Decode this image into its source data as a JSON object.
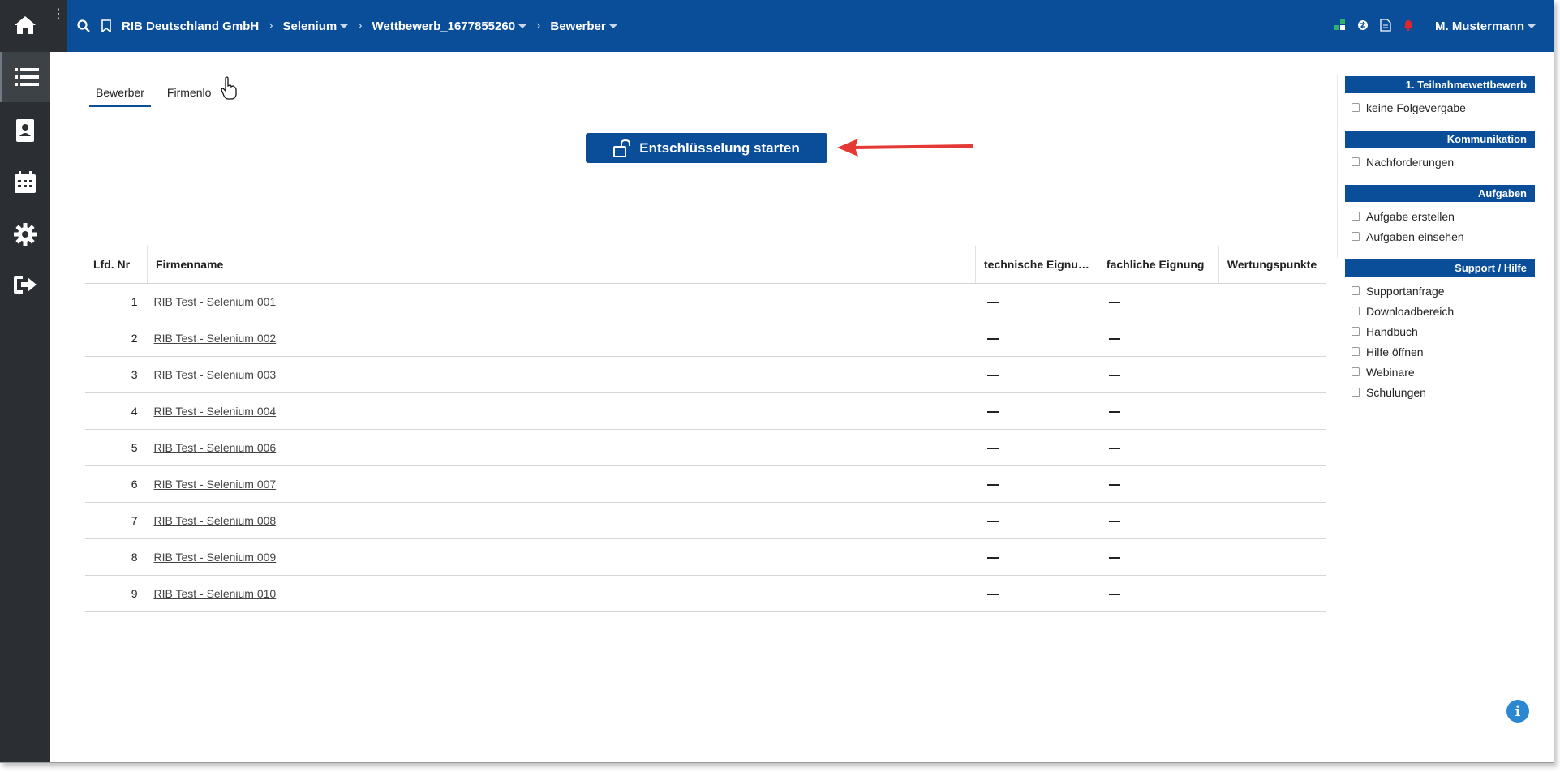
{
  "topbar": {
    "breadcrumbs": [
      {
        "label": "RIB Deutschland GmbH",
        "dropdown": false
      },
      {
        "label": "Selenium",
        "dropdown": true
      },
      {
        "label": "Wettbewerb_1677855260",
        "dropdown": true
      },
      {
        "label": "Bewerber",
        "dropdown": true
      }
    ],
    "user": "M. Mustermann"
  },
  "rail": {
    "items": [
      "home-icon",
      "list-icon",
      "contacts-icon",
      "calendar-icon",
      "gear-icon",
      "logout-icon"
    ]
  },
  "tabs": [
    {
      "label": "Bewerber",
      "active": true
    },
    {
      "label": "Firmenlo",
      "active": false
    }
  ],
  "decrypt_button": {
    "label": "Entschlüsselung starten"
  },
  "table": {
    "headers": [
      "Lfd. Nr",
      "Firmenname",
      "technische Eignu…",
      "fachliche Eignung",
      "Wertungspunkte"
    ],
    "rows": [
      {
        "nr": "1",
        "name": "RIB Test - Selenium 001"
      },
      {
        "nr": "2",
        "name": "RIB Test - Selenium 002"
      },
      {
        "nr": "3",
        "name": "RIB Test - Selenium 003"
      },
      {
        "nr": "4",
        "name": "RIB Test - Selenium 004"
      },
      {
        "nr": "5",
        "name": "RIB Test - Selenium 006"
      },
      {
        "nr": "6",
        "name": "RIB Test - Selenium 007"
      },
      {
        "nr": "7",
        "name": "RIB Test - Selenium 008"
      },
      {
        "nr": "8",
        "name": "RIB Test - Selenium 009"
      },
      {
        "nr": "9",
        "name": "RIB Test - Selenium 010"
      }
    ]
  },
  "side": {
    "groups": [
      {
        "title": "1. Teilnahmewettbewerb",
        "links": [
          "keine Folgevergabe"
        ]
      },
      {
        "title": "Kommunikation",
        "links": [
          "Nachforderungen"
        ]
      },
      {
        "title": "Aufgaben",
        "links": [
          "Aufgabe erstellen",
          "Aufgaben einsehen"
        ]
      },
      {
        "title": "Support / Hilfe",
        "links": [
          "Supportanfrage",
          "Downloadbereich",
          "Handbuch",
          "Hilfe öffnen",
          "Webinare",
          "Schulungen"
        ]
      }
    ]
  },
  "colors": {
    "brand": "#0a4e9a",
    "rail": "#2b2f33",
    "annotation_arrow": "#e53935",
    "info": "#2a87d1"
  }
}
